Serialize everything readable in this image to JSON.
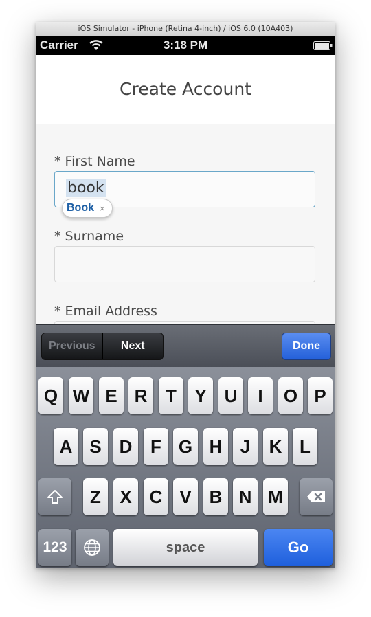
{
  "window": {
    "title": "iOS Simulator - iPhone (Retina 4-inch) / iOS 6.0 (10A403)"
  },
  "status_bar": {
    "carrier": "Carrier",
    "time": "3:18 PM"
  },
  "nav": {
    "title": "Create Account"
  },
  "form": {
    "first_name_label": "* First Name",
    "first_name_value": "book",
    "autocorrect_suggestion": "Book",
    "autocorrect_dismiss": "×",
    "surname_label": "* Surname",
    "surname_value": "",
    "email_label": "* Email Address"
  },
  "keyboard_toolbar": {
    "previous": "Previous",
    "next": "Next",
    "done": "Done"
  },
  "keyboard": {
    "row1": [
      "Q",
      "W",
      "E",
      "R",
      "T",
      "Y",
      "U",
      "I",
      "O",
      "P"
    ],
    "row2": [
      "A",
      "S",
      "D",
      "F",
      "G",
      "H",
      "J",
      "K",
      "L"
    ],
    "row3": [
      "Z",
      "X",
      "C",
      "V",
      "B",
      "N",
      "M"
    ],
    "numbers_key": "123",
    "space_key": "space",
    "go_key": "Go"
  },
  "icons": {
    "wifi": "wifi-icon",
    "battery": "battery-icon",
    "shift": "shift-icon",
    "backspace": "backspace-icon",
    "globe": "globe-icon"
  },
  "colors": {
    "done_blue": "#2460d9",
    "field_focus": "#6aa7c9",
    "autocorrect_text": "#1d5fa5"
  }
}
